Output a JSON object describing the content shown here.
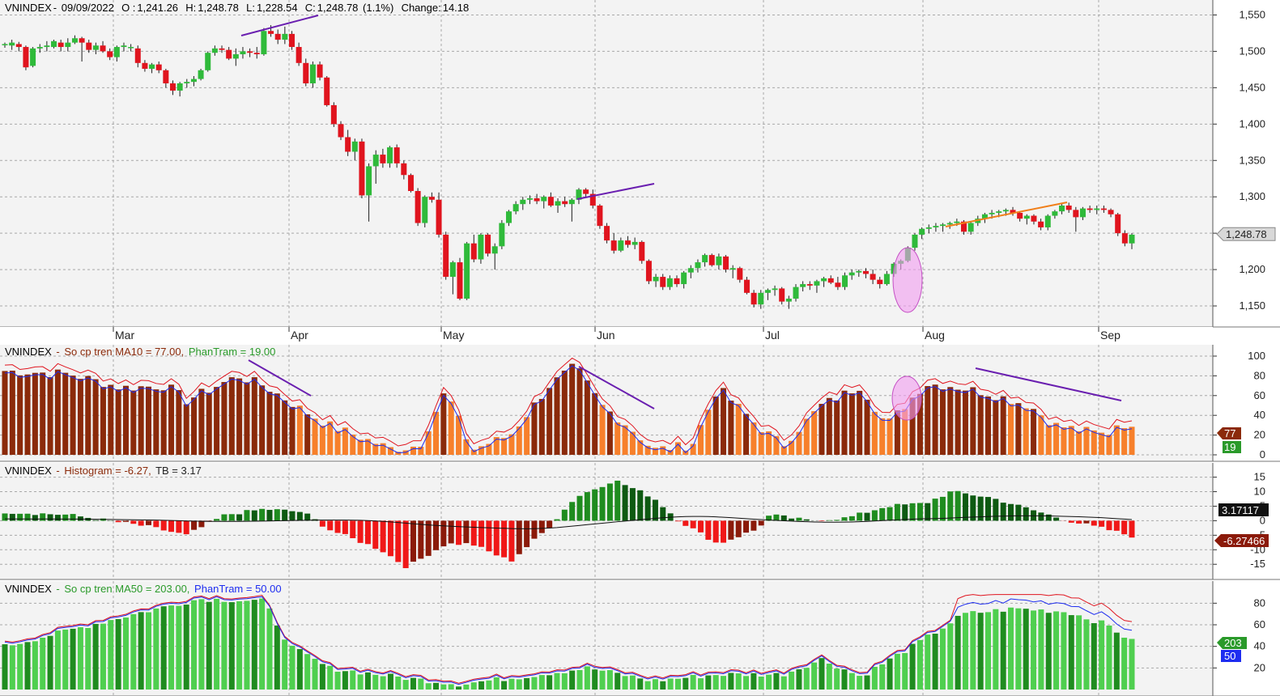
{
  "colors": {
    "up": "#2fba3a",
    "down": "#e0141e",
    "wick": "#1f1f1f",
    "grid": "#a8a8a8",
    "bg": "#ececec",
    "divergence": "#6a1fb0",
    "trend_orange": "#f07f1a",
    "highlight": "#f19df0",
    "ma10_dark": "#8b2a0a",
    "ma10_light": "#f7802b",
    "hist_green": "#1f8c1f",
    "hist_dark": "#0e5a12",
    "hist_red": "#f01818",
    "hist_darkred": "#8b1a0a",
    "ma50_light": "#4fcf4f",
    "ma50_dark": "#1f8c1f",
    "line_red": "#e0141e",
    "line_blue": "#1e2df0"
  },
  "panel1": {
    "symbol": "VNINDEX",
    "date": "09/09/2022",
    "open_label": "O :",
    "open": "1,241.26",
    "high_label": "H:",
    "high": "1,248.78",
    "low_label": "L:",
    "low": "1,228.54",
    "close_label": "C:",
    "close": "1,248.78",
    "change_pct": "(1.1%)",
    "change_label": "Change:",
    "change": "14.18",
    "last_label": "1,248.78"
  },
  "panel2": {
    "symbol": "VNINDEX",
    "sep": "-",
    "indicator": "So cp tren MA10 = 77.00,",
    "line_label": "PhanTram = 19.00",
    "value_a": "77",
    "value_b": "19"
  },
  "panel3": {
    "symbol": "VNINDEX",
    "sep": "-",
    "indicator": "Histogram = -6.27,",
    "line_label": "TB = 3.17",
    "value_a": "3.17117",
    "value_b": "-6.27466"
  },
  "panel4": {
    "symbol": "VNINDEX",
    "sep": "-",
    "indicator": "So cp tren MA50 = 203.00,",
    "line_label": "PhanTram = 50.00",
    "value_a": "203",
    "value_b": "50"
  },
  "chart_data": [
    {
      "type": "candlestick",
      "title": "VNINDEX - 09/09/2022",
      "x_months": [
        "Mar",
        "Apr",
        "May",
        "Jun",
        "Jul",
        "Aug",
        "Sep"
      ],
      "y_ticks": [
        1150,
        1200,
        1250,
        1300,
        1350,
        1400,
        1450,
        1500,
        1550
      ],
      "ylim": [
        1130,
        1555
      ],
      "ohlc": [
        [
          1510,
          1512,
          1505,
          1510
        ],
        [
          1508,
          1516,
          1502,
          1512
        ],
        [
          1510,
          1513,
          1500,
          1506
        ],
        [
          1506,
          1508,
          1474,
          1478
        ],
        [
          1480,
          1506,
          1478,
          1504
        ],
        [
          1504,
          1510,
          1498,
          1506
        ],
        [
          1506,
          1514,
          1500,
          1508
        ],
        [
          1506,
          1516,
          1504,
          1514
        ],
        [
          1512,
          1516,
          1500,
          1506
        ],
        [
          1506,
          1518,
          1500,
          1512
        ],
        [
          1512,
          1522,
          1510,
          1518
        ],
        [
          1518,
          1520,
          1486,
          1512
        ],
        [
          1512,
          1516,
          1498,
          1502
        ],
        [
          1502,
          1512,
          1496,
          1508
        ],
        [
          1508,
          1514,
          1498,
          1500
        ],
        [
          1500,
          1504,
          1488,
          1492
        ],
        [
          1492,
          1508,
          1486,
          1506
        ],
        [
          1506,
          1512,
          1500,
          1508
        ],
        [
          1506,
          1510,
          1500,
          1506
        ],
        [
          1504,
          1508,
          1478,
          1484
        ],
        [
          1484,
          1488,
          1472,
          1476
        ],
        [
          1476,
          1484,
          1470,
          1482
        ],
        [
          1482,
          1486,
          1470,
          1474
        ],
        [
          1474,
          1476,
          1450,
          1456
        ],
        [
          1456,
          1460,
          1440,
          1446
        ],
        [
          1446,
          1458,
          1438,
          1456
        ],
        [
          1456,
          1462,
          1450,
          1458
        ],
        [
          1458,
          1466,
          1452,
          1462
        ],
        [
          1462,
          1476,
          1460,
          1474
        ],
        [
          1474,
          1500,
          1472,
          1498
        ],
        [
          1498,
          1508,
          1494,
          1504
        ],
        [
          1504,
          1508,
          1498,
          1502
        ],
        [
          1502,
          1506,
          1488,
          1490
        ],
        [
          1490,
          1504,
          1480,
          1496
        ],
        [
          1496,
          1506,
          1490,
          1500
        ],
        [
          1500,
          1504,
          1492,
          1498
        ],
        [
          1498,
          1506,
          1490,
          1496
        ],
        [
          1496,
          1532,
          1494,
          1528
        ],
        [
          1528,
          1536,
          1520,
          1524
        ],
        [
          1524,
          1530,
          1510,
          1516
        ],
        [
          1516,
          1534,
          1510,
          1524
        ],
        [
          1524,
          1528,
          1502,
          1506
        ],
        [
          1506,
          1512,
          1480,
          1484
        ],
        [
          1484,
          1490,
          1452,
          1456
        ],
        [
          1456,
          1486,
          1450,
          1482
        ],
        [
          1482,
          1486,
          1460,
          1464
        ],
        [
          1464,
          1466,
          1424,
          1426
        ],
        [
          1426,
          1430,
          1396,
          1400
        ],
        [
          1400,
          1404,
          1378,
          1382
        ],
        [
          1382,
          1392,
          1356,
          1362
        ],
        [
          1362,
          1380,
          1350,
          1376
        ],
        [
          1376,
          1380,
          1298,
          1302
        ],
        [
          1302,
          1346,
          1266,
          1342
        ],
        [
          1342,
          1364,
          1318,
          1358
        ],
        [
          1358,
          1366,
          1340,
          1346
        ],
        [
          1346,
          1370,
          1340,
          1368
        ],
        [
          1368,
          1372,
          1340,
          1346
        ],
        [
          1346,
          1350,
          1324,
          1330
        ],
        [
          1330,
          1332,
          1306,
          1308
        ],
        [
          1308,
          1312,
          1260,
          1264
        ],
        [
          1264,
          1302,
          1258,
          1300
        ],
        [
          1300,
          1306,
          1292,
          1296
        ],
        [
          1296,
          1306,
          1244,
          1248
        ],
        [
          1248,
          1252,
          1186,
          1190
        ],
        [
          1190,
          1212,
          1166,
          1210
        ],
        [
          1210,
          1216,
          1158,
          1160
        ],
        [
          1160,
          1238,
          1158,
          1236
        ],
        [
          1236,
          1248,
          1210,
          1214
        ],
        [
          1214,
          1250,
          1208,
          1248
        ],
        [
          1248,
          1250,
          1218,
          1222
        ],
        [
          1222,
          1236,
          1200,
          1232
        ],
        [
          1232,
          1268,
          1228,
          1264
        ],
        [
          1264,
          1282,
          1260,
          1280
        ],
        [
          1280,
          1294,
          1276,
          1290
        ],
        [
          1290,
          1300,
          1282,
          1296
        ],
        [
          1296,
          1302,
          1290,
          1298
        ],
        [
          1298,
          1304,
          1290,
          1294
        ],
        [
          1294,
          1302,
          1284,
          1300
        ],
        [
          1300,
          1306,
          1286,
          1288
        ],
        [
          1288,
          1298,
          1278,
          1294
        ],
        [
          1294,
          1300,
          1286,
          1290
        ],
        [
          1290,
          1298,
          1266,
          1296
        ],
        [
          1296,
          1312,
          1290,
          1310
        ],
        [
          1310,
          1312,
          1300,
          1304
        ],
        [
          1304,
          1310,
          1284,
          1288
        ],
        [
          1288,
          1290,
          1256,
          1260
        ],
        [
          1260,
          1264,
          1236,
          1240
        ],
        [
          1240,
          1250,
          1222,
          1226
        ],
        [
          1226,
          1244,
          1224,
          1240
        ],
        [
          1240,
          1246,
          1230,
          1234
        ],
        [
          1234,
          1244,
          1228,
          1238
        ],
        [
          1238,
          1240,
          1208,
          1212
        ],
        [
          1212,
          1214,
          1180,
          1184
        ],
        [
          1184,
          1194,
          1176,
          1190
        ],
        [
          1190,
          1194,
          1172,
          1176
        ],
        [
          1176,
          1192,
          1172,
          1188
        ],
        [
          1188,
          1192,
          1176,
          1180
        ],
        [
          1180,
          1198,
          1174,
          1196
        ],
        [
          1196,
          1206,
          1188,
          1202
        ],
        [
          1202,
          1214,
          1196,
          1210
        ],
        [
          1210,
          1222,
          1204,
          1220
        ],
        [
          1220,
          1222,
          1204,
          1206
        ],
        [
          1206,
          1222,
          1200,
          1218
        ],
        [
          1218,
          1220,
          1196,
          1200
        ],
        [
          1200,
          1206,
          1188,
          1202
        ],
        [
          1202,
          1204,
          1182,
          1186
        ],
        [
          1186,
          1190,
          1166,
          1168
        ],
        [
          1168,
          1172,
          1148,
          1152
        ],
        [
          1152,
          1172,
          1146,
          1168
        ],
        [
          1168,
          1174,
          1158,
          1172
        ],
        [
          1172,
          1178,
          1164,
          1174
        ],
        [
          1174,
          1176,
          1152,
          1156
        ],
        [
          1156,
          1164,
          1146,
          1160
        ],
        [
          1160,
          1180,
          1156,
          1176
        ],
        [
          1176,
          1184,
          1170,
          1180
        ],
        [
          1180,
          1184,
          1172,
          1178
        ],
        [
          1178,
          1186,
          1168,
          1184
        ],
        [
          1184,
          1190,
          1176,
          1188
        ],
        [
          1188,
          1192,
          1180,
          1182
        ],
        [
          1182,
          1190,
          1172,
          1176
        ],
        [
          1176,
          1196,
          1172,
          1192
        ],
        [
          1192,
          1200,
          1186,
          1196
        ],
        [
          1196,
          1200,
          1190,
          1198
        ],
        [
          1198,
          1202,
          1188,
          1194
        ],
        [
          1194,
          1200,
          1180,
          1186
        ],
        [
          1186,
          1190,
          1174,
          1180
        ],
        [
          1180,
          1198,
          1178,
          1194
        ],
        [
          1194,
          1210,
          1190,
          1208
        ],
        [
          1208,
          1214,
          1200,
          1212
        ],
        [
          1212,
          1232,
          1210,
          1230
        ],
        [
          1230,
          1250,
          1226,
          1248
        ],
        [
          1248,
          1258,
          1242,
          1256
        ],
        [
          1256,
          1262,
          1250,
          1258
        ],
        [
          1258,
          1264,
          1252,
          1260
        ],
        [
          1260,
          1264,
          1252,
          1262
        ],
        [
          1262,
          1266,
          1256,
          1264
        ],
        [
          1264,
          1270,
          1260,
          1266
        ],
        [
          1266,
          1268,
          1248,
          1252
        ],
        [
          1252,
          1266,
          1248,
          1264
        ],
        [
          1264,
          1274,
          1260,
          1270
        ],
        [
          1270,
          1278,
          1264,
          1276
        ],
        [
          1276,
          1282,
          1270,
          1278
        ],
        [
          1278,
          1282,
          1272,
          1280
        ],
        [
          1280,
          1284,
          1274,
          1282
        ],
        [
          1282,
          1286,
          1274,
          1278
        ],
        [
          1278,
          1280,
          1266,
          1270
        ],
        [
          1270,
          1276,
          1262,
          1274
        ],
        [
          1274,
          1276,
          1262,
          1266
        ],
        [
          1266,
          1270,
          1254,
          1258
        ],
        [
          1258,
          1276,
          1254,
          1274
        ],
        [
          1274,
          1282,
          1270,
          1280
        ],
        [
          1280,
          1290,
          1276,
          1288
        ],
        [
          1288,
          1292,
          1278,
          1282
        ],
        [
          1282,
          1286,
          1252,
          1272
        ],
        [
          1272,
          1286,
          1268,
          1284
        ],
        [
          1284,
          1288,
          1278,
          1282
        ],
        [
          1282,
          1288,
          1276,
          1284
        ],
        [
          1284,
          1288,
          1278,
          1282
        ],
        [
          1282,
          1284,
          1272,
          1276
        ],
        [
          1276,
          1278,
          1246,
          1250
        ],
        [
          1250,
          1254,
          1232,
          1236
        ],
        [
          1236,
          1250,
          1228,
          1248
        ]
      ]
    },
    {
      "type": "bar+line",
      "title": "VNINDEX - So cp tren MA10 = 77.00, PhanTram = 19.00",
      "y_ticks": [
        0,
        20,
        40,
        60,
        80,
        100
      ],
      "ylim": [
        0,
        100
      ]
    },
    {
      "type": "bar+line",
      "title": "VNINDEX - Histogram = -6.27, TB = 3.17",
      "y_ticks": [
        -15,
        -10,
        -5,
        0,
        5,
        10,
        15
      ],
      "ylim": [
        -18,
        16
      ]
    },
    {
      "type": "bar+line",
      "title": "VNINDEX - So cp tren MA50 = 203.00, PhanTram = 50.00",
      "y_ticks": [
        20,
        40,
        60,
        80
      ],
      "ylim": [
        0,
        90
      ]
    }
  ]
}
